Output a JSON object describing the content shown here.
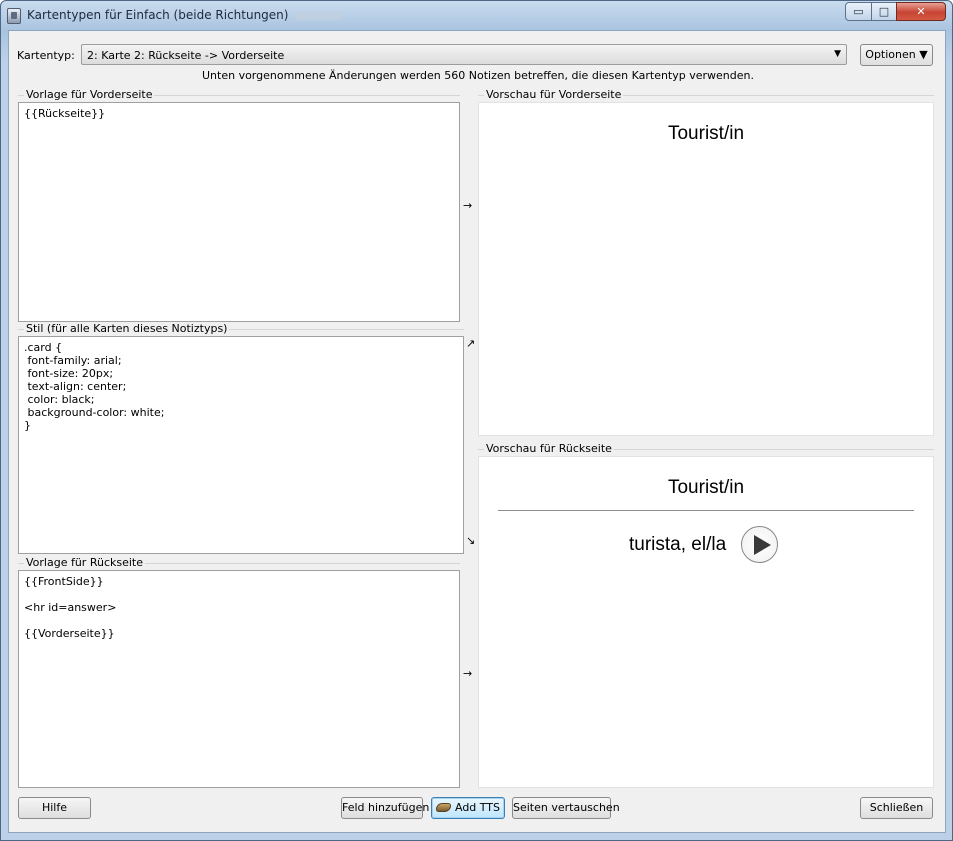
{
  "window": {
    "title": "Kartentypen für Einfach (beide Richtungen)",
    "minimize_label": "▭",
    "maximize_label": "□",
    "close_label": "✕"
  },
  "toolbar": {
    "card_type_label": "Kartentyp:",
    "card_type_selected": "2: Karte 2: Rückseite -> Vorderseite",
    "options_label": "Optionen ▼"
  },
  "notice": "Unten vorgenommene Änderungen werden 560 Notizen betreffen, die diesen Kartentyp verwenden.",
  "front_template": {
    "title": "Vorlage für Vorderseite",
    "content": "{{Rückseite}}"
  },
  "style": {
    "title": "Stil (für alle Karten dieses Notiztyps)",
    "content": ".card {\n font-family: arial;\n font-size: 20px;\n text-align: center;\n color: black;\n background-color: white;\n}"
  },
  "back_template": {
    "title": "Vorlage für Rückseite",
    "content": "{{FrontSide}}\n\n<hr id=answer>\n\n{{Vorderseite}}"
  },
  "front_preview": {
    "title": "Vorschau für Vorderseite",
    "question": "Tourist/in"
  },
  "back_preview": {
    "title": "Vorschau für Rückseite",
    "question": "Tourist/in",
    "answer": "turista, el/la"
  },
  "arrows": {
    "front": "→",
    "style_up": "↗",
    "style_down": "↘",
    "back": "→"
  },
  "buttons": {
    "help": "Hilfe",
    "add_field": "Feld hinzufügen",
    "add_tts": "Add TTS",
    "swap_sides": "Seiten vertauschen",
    "close": "Schließen"
  }
}
